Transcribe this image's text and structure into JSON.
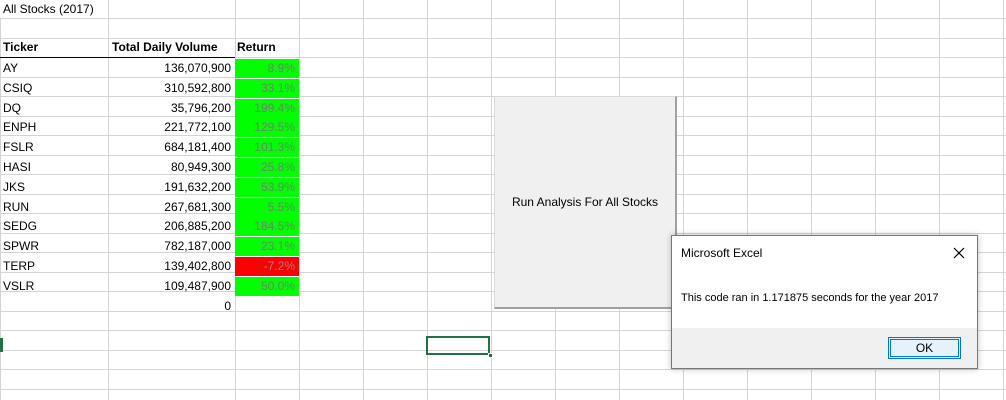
{
  "sheet": {
    "title": "All Stocks (2017)",
    "headers": {
      "ticker": "Ticker",
      "volume": "Total Daily Volume",
      "return": "Return"
    },
    "rows": [
      {
        "ticker": "AY",
        "volume": "136,070,900",
        "return": "8.9%",
        "status": "positive"
      },
      {
        "ticker": "CSIQ",
        "volume": "310,592,800",
        "return": "33.1%",
        "status": "positive"
      },
      {
        "ticker": "DQ",
        "volume": "35,796,200",
        "return": "199.4%",
        "status": "positive"
      },
      {
        "ticker": "ENPH",
        "volume": "221,772,100",
        "return": "129.5%",
        "status": "positive"
      },
      {
        "ticker": "FSLR",
        "volume": "684,181,400",
        "return": "101.3%",
        "status": "positive"
      },
      {
        "ticker": "HASI",
        "volume": "80,949,300",
        "return": "25.8%",
        "status": "positive"
      },
      {
        "ticker": "JKS",
        "volume": "191,632,200",
        "return": "53.9%",
        "status": "positive"
      },
      {
        "ticker": "RUN",
        "volume": "267,681,300",
        "return": "5.5%",
        "status": "positive"
      },
      {
        "ticker": "SEDG",
        "volume": "206,885,200",
        "return": "184.5%",
        "status": "positive"
      },
      {
        "ticker": "SPWR",
        "volume": "782,187,000",
        "return": "23.1%",
        "status": "positive"
      },
      {
        "ticker": "TERP",
        "volume": "139,402,800",
        "return": "-7.2%",
        "status": "negative"
      },
      {
        "ticker": "VSLR",
        "volume": "109,487,900",
        "return": "50.0%",
        "status": "positive"
      }
    ],
    "extra_volume": "0",
    "colors": {
      "positive": "#00ff00",
      "negative": "#ff0000",
      "selection": "#217346",
      "grid": "#d4d4d4"
    }
  },
  "run_button": {
    "label": "Run Analysis For All Stocks"
  },
  "dialog": {
    "title": "Microsoft Excel",
    "message": "This code ran in 1.171875 seconds for the year 2017",
    "ok_label": "OK",
    "close_icon": "close-icon"
  }
}
